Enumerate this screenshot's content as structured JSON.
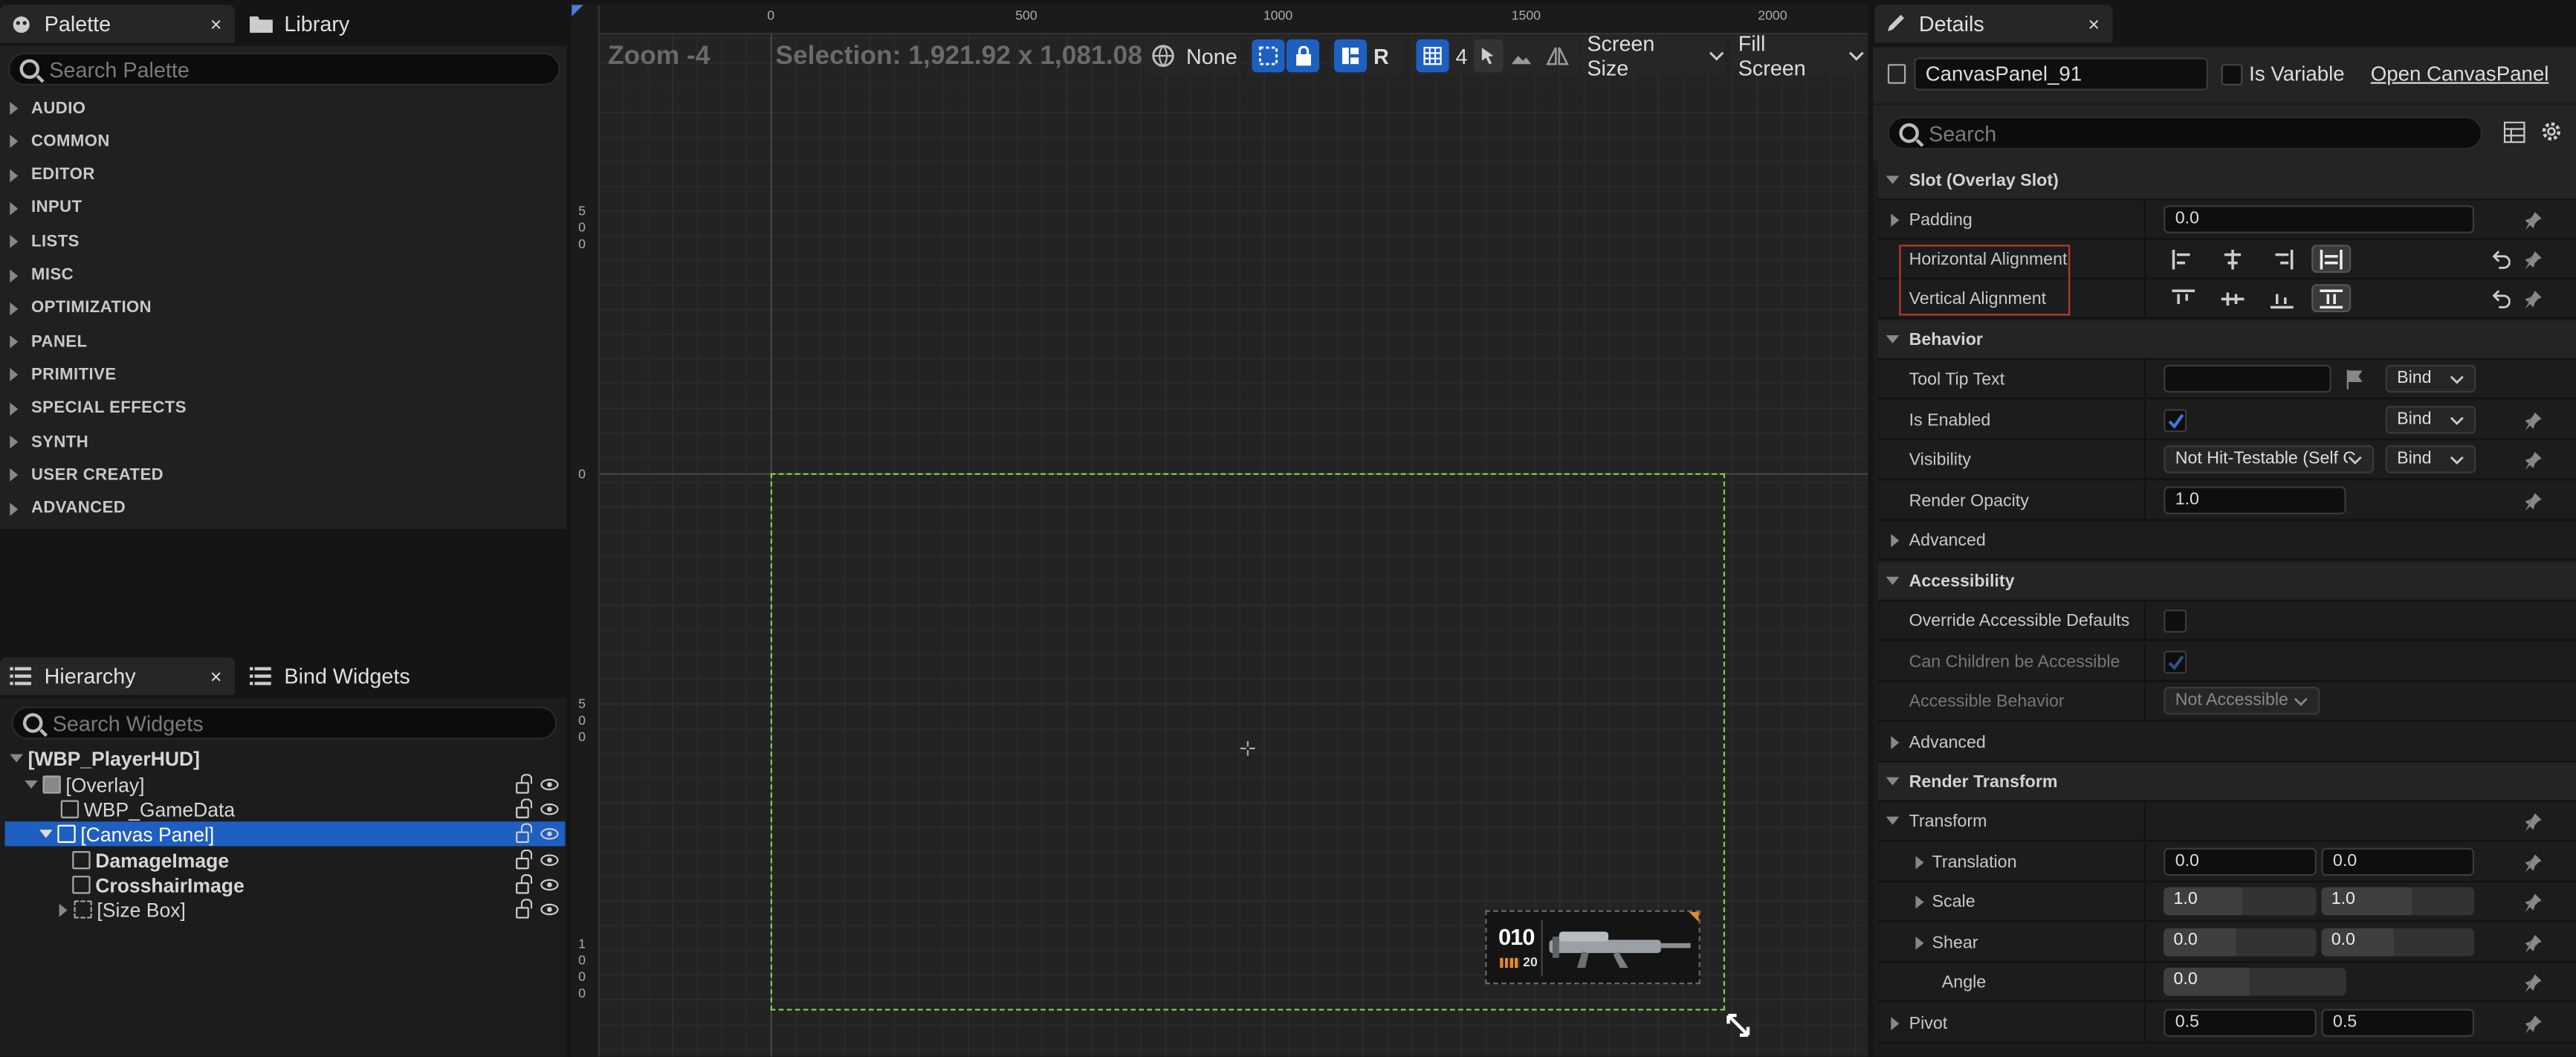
{
  "palette": {
    "tab_palette": "Palette",
    "tab_library": "Library",
    "close": "×",
    "search_placeholder": "Search Palette",
    "categories": [
      "AUDIO",
      "COMMON",
      "EDITOR",
      "INPUT",
      "LISTS",
      "MISC",
      "OPTIMIZATION",
      "PANEL",
      "PRIMITIVE",
      "SPECIAL EFFECTS",
      "SYNTH",
      "USER CREATED",
      "ADVANCED"
    ]
  },
  "hierarchy": {
    "tab_hierarchy": "Hierarchy",
    "tab_bind": "Bind Widgets",
    "close": "×",
    "search_placeholder": "Search Widgets",
    "items": [
      "[WBP_PlayerHUD]",
      "[Overlay]",
      "WBP_GameData",
      "[Canvas Panel]",
      "DamageImage",
      "CrosshairImage",
      "[Size Box]"
    ]
  },
  "viewport": {
    "zoom": "Zoom -4",
    "selection": "Selection: 1,921.92 x 1,081.08",
    "none_label": "None",
    "r_label": "R",
    "grid_count": "4",
    "screen_size": "Screen Size",
    "fill_screen": "Fill Screen",
    "ruler_top": [
      "0",
      "500",
      "1000",
      "1500",
      "2000"
    ],
    "ruler_left": [
      "500",
      "0",
      "500",
      "1000"
    ],
    "ammo_count": "010",
    "ammo_reserve": "20"
  },
  "details": {
    "tab": "Details",
    "close": "×",
    "widget_name": "CanvasPanel_91",
    "is_variable": "Is Variable",
    "open_link": "Open CanvasPanel",
    "search_placeholder": "Search",
    "sections": {
      "slot": "Slot (Overlay Slot)",
      "behavior": "Behavior",
      "accessibility": "Accessibility",
      "render_transform": "Render Transform"
    },
    "labels": {
      "padding": "Padding",
      "h_align": "Horizontal Alignment",
      "v_align": "Vertical Alignment",
      "tooltip": "Tool Tip Text",
      "is_enabled": "Is Enabled",
      "visibility": "Visibility",
      "render_opacity": "Render Opacity",
      "advanced": "Advanced",
      "override_acc": "Override Accessible Defaults",
      "children_acc": "Can Children be Accessible",
      "acc_behavior": "Accessible Behavior",
      "transform": "Transform",
      "translation": "Translation",
      "scale": "Scale",
      "shear": "Shear",
      "angle": "Angle",
      "pivot": "Pivot"
    },
    "values": {
      "padding": "0.0",
      "bind": "Bind",
      "visibility": "Not Hit-Testable (Self O",
      "render_opacity": "1.0",
      "acc_behavior": "Not Accessible",
      "translation_x": "0.0",
      "translation_y": "0.0",
      "scale_x": "1.0",
      "scale_y": "1.0",
      "shear_x": "0.0",
      "shear_y": "0.0",
      "angle": "0.0",
      "pivot_x": "0.5",
      "pivot_y": "0.5"
    }
  },
  "colors": {
    "accent": "#1e5fc2",
    "selection_green": "#7dd14a",
    "highlight_red": "#c0392b"
  }
}
